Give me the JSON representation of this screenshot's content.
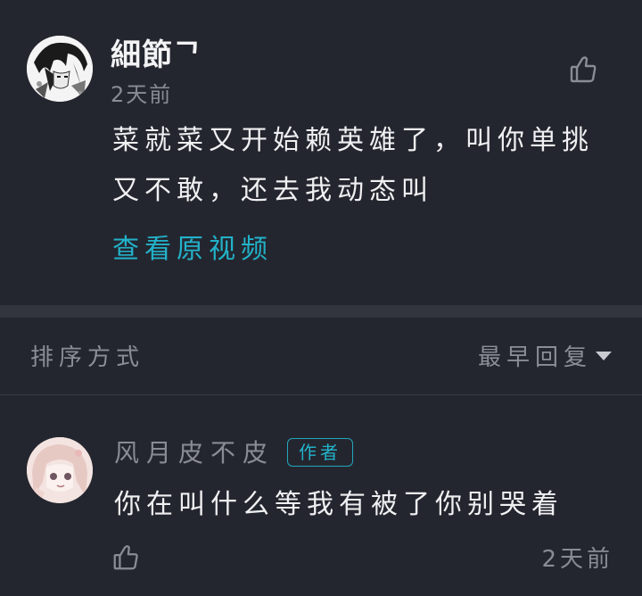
{
  "colors": {
    "background": "#24262f",
    "accent": "#22b2c9",
    "muted_text": "#8a8c93",
    "primary_text": "#f0f0f2"
  },
  "main_comment": {
    "username": "細節ᄀ",
    "time": "2天前",
    "text": "菜就菜又开始赖英雄了，叫你单挑又不敢，还去我动态叫",
    "view_video_label": "查看原视频",
    "like_icon": "thumbs-up-icon",
    "avatar_icon": "manga-avatar"
  },
  "sort": {
    "label": "排序方式",
    "selected": "最早回复",
    "dropdown_icon": "caret-down-icon"
  },
  "reply": {
    "username": "风月皮不皮",
    "badge": "作者",
    "text": "你在叫什么等我有被了你别哭着",
    "time": "2天前",
    "like_icon": "thumbs-up-icon",
    "avatar_icon": "anime-girl-avatar"
  }
}
